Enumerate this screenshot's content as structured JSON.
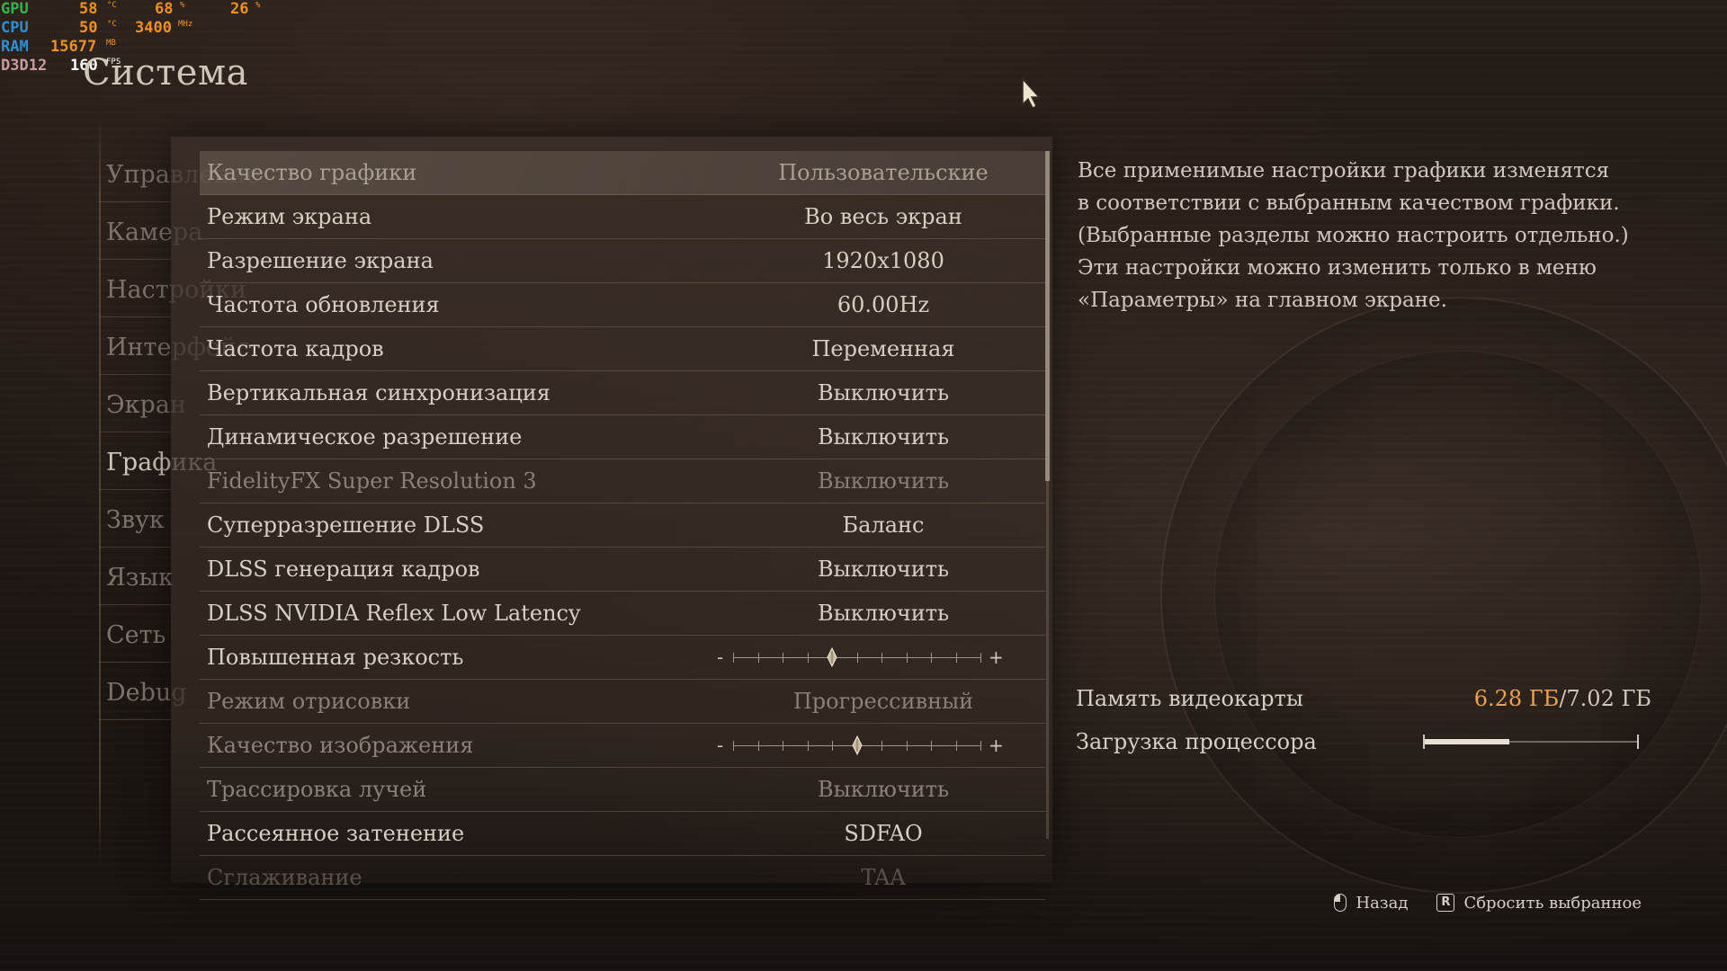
{
  "hud": {
    "gpu": {
      "label": "GPU",
      "temp": "58",
      "temp_unit": "°C",
      "load": "68",
      "load_unit": "%",
      "extra": "26",
      "extra_unit": "%"
    },
    "cpu": {
      "label": "CPU",
      "temp": "50",
      "temp_unit": "°C",
      "clock": "3400",
      "clock_unit": "MHz"
    },
    "ram": {
      "label": "RAM",
      "value": "15677",
      "unit": "MB"
    },
    "api": {
      "label": "D3D12",
      "fps": "160",
      "fps_unit": "FPS"
    }
  },
  "page": {
    "title": "Система"
  },
  "sidebar": {
    "items": [
      {
        "label": "Управление",
        "active": false
      },
      {
        "label": "Камера",
        "active": false
      },
      {
        "label": "Настройки",
        "active": false
      },
      {
        "label": "Интерфейс",
        "active": false
      },
      {
        "label": "Экран",
        "active": false
      },
      {
        "label": "Графика",
        "active": true
      },
      {
        "label": "Звук",
        "active": false
      },
      {
        "label": "Язык",
        "active": false
      },
      {
        "label": "Сеть",
        "active": false
      },
      {
        "label": "Debug",
        "active": false
      }
    ]
  },
  "settings": {
    "rows": [
      {
        "label": "Качество графики",
        "value": "Пользовательские",
        "state": "selected"
      },
      {
        "label": "Режим экрана",
        "value": "Во весь экран",
        "state": "normal"
      },
      {
        "label": "Разрешение экрана",
        "value": "1920x1080",
        "state": "normal"
      },
      {
        "label": "Частота обновления",
        "value": "60.00Hz",
        "state": "normal"
      },
      {
        "label": "Частота кадров",
        "value": "Переменная",
        "state": "normal"
      },
      {
        "label": "Вертикальная синхронизация",
        "value": "Выключить",
        "state": "normal"
      },
      {
        "label": "Динамическое разрешение",
        "value": "Выключить",
        "state": "normal"
      },
      {
        "label": "FidelityFX Super Resolution 3",
        "value": "Выключить",
        "state": "dim"
      },
      {
        "label": "Суперразрешение DLSS",
        "value": "Баланс",
        "state": "normal"
      },
      {
        "label": "DLSS генерация кадров",
        "value": "Выключить",
        "state": "normal"
      },
      {
        "label": "DLSS NVIDIA Reflex Low Latency",
        "value": "Выключить",
        "state": "normal"
      },
      {
        "label": "Повышенная резкость",
        "value": "",
        "state": "normal",
        "slider": {
          "min_symbol": "-",
          "max_symbol": "+",
          "level": 0.4
        }
      },
      {
        "label": "Режим отрисовки",
        "value": "Прогрессивный",
        "state": "dim"
      },
      {
        "label": "Качество изображения",
        "value": "",
        "state": "dim",
        "slider": {
          "min_symbol": "-",
          "max_symbol": "+",
          "level": 0.5
        }
      },
      {
        "label": "Трассировка лучей",
        "value": "Выключить",
        "state": "dim"
      },
      {
        "label": "Рассеянное затенение",
        "value": "SDFAO",
        "state": "normal"
      },
      {
        "label": "Сглаживание",
        "value": "TAA",
        "state": "faded"
      }
    ],
    "scroll_fraction": 0.48
  },
  "description": {
    "lines": [
      "Все применимые настройки графики изменятся",
      "в соответствии с выбранным качеством графики.",
      "(Выбранные разделы можно настроить отдельно.)",
      "Эти настройки можно изменить только в меню",
      "«Параметры» на главном экране."
    ]
  },
  "stats": {
    "vram": {
      "label": "Память видеокарты",
      "used": "6.28 ГБ",
      "separator": "/",
      "total": "7.02 ГБ"
    },
    "cpu_load": {
      "label": "Загрузка процессора",
      "level": 0.4
    }
  },
  "footer": {
    "back_label": "Назад",
    "reset_key": "R",
    "reset_label": "Сбросить выбранное"
  },
  "colors": {
    "accent": "#f0a04a",
    "hud_gpu": "#36b34a",
    "hud_cpu": "#2d8fd6",
    "hud_value": "#f0911e"
  },
  "icons": {
    "back_button": "mouse-icon",
    "reset_button": "key-r-icon",
    "pointer": "cursor-icon"
  }
}
